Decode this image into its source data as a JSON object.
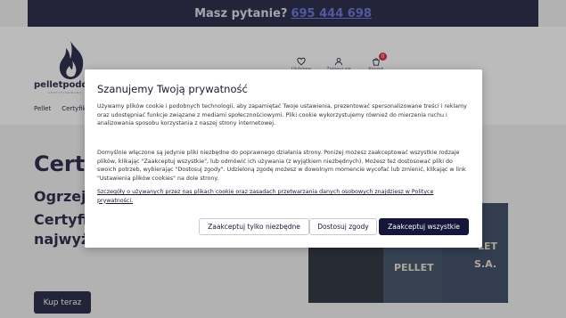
{
  "topbar": {
    "question": "Masz pytanie?",
    "phone": "695 444 698"
  },
  "logo": {
    "text": "pelletpodd",
    "subtext": "CERTYFIKOWANY"
  },
  "header_icons": [
    {
      "icon": "heart-icon",
      "label": "Ulubione"
    },
    {
      "icon": "user-icon",
      "label": "Zaloguj się"
    },
    {
      "icon": "cart-icon",
      "label": "Koszyk",
      "badge": "0"
    }
  ],
  "nav": {
    "items": [
      "Pellet",
      "Certyfik"
    ]
  },
  "hero": {
    "title": "Certy",
    "line1": "Ogrzej s",
    "line2": "Certyfik",
    "line3": "najwyż",
    "buy_label": "Kup teraz",
    "bag_labels": [
      "PELLET",
      "LET",
      "S.A."
    ]
  },
  "cookie_modal": {
    "title": "Szanujemy Twoją prywatność",
    "paragraph1": "Używamy plików cookie i podobnych technologii, aby zapamiętać Twoje ustawienia, prezentować spersonalizowane treści i reklamy oraz udostępniać funkcje związane z mediami społecznościowymi. Pliki cookie wykorzystujemy również do mierzenia ruchu i analizowania sposobu korzystania z naszej strony internetowej.",
    "paragraph2": "Domyślnie włączone są jedynie pliki niezbędne do poprawnego działania strony. Poniżej możesz zaakceptować wszystkie rodzaje plików, klikając \"Zaakceptuj wszystkie\", lub odmówić ich używania (z wyjątkiem niezbędnych). Możesz też dostosować pliki do swoich potrzeb, wybierając \"Dostosuj zgody\". Udzieloną zgodę możesz w dowolnym momencie wycofać lub zmienić, klikając w link \"Ustawienia plików cookies\" na dole strony.",
    "link_text": "Szczegóły o używanych przez nas plikach cookie oraz zasadach przetwarzania danych osobowych znajdziesz w Polityce prywatności.",
    "buttons": {
      "necessary": "Zaakceptuj tylko niezbędne",
      "customize": "Dostosuj zgody",
      "accept_all": "Zaakceptuj wszystkie"
    }
  },
  "colors": {
    "navy": "#16163a",
    "accent_link": "#5b6bd8",
    "badge_red": "#d8172b"
  }
}
